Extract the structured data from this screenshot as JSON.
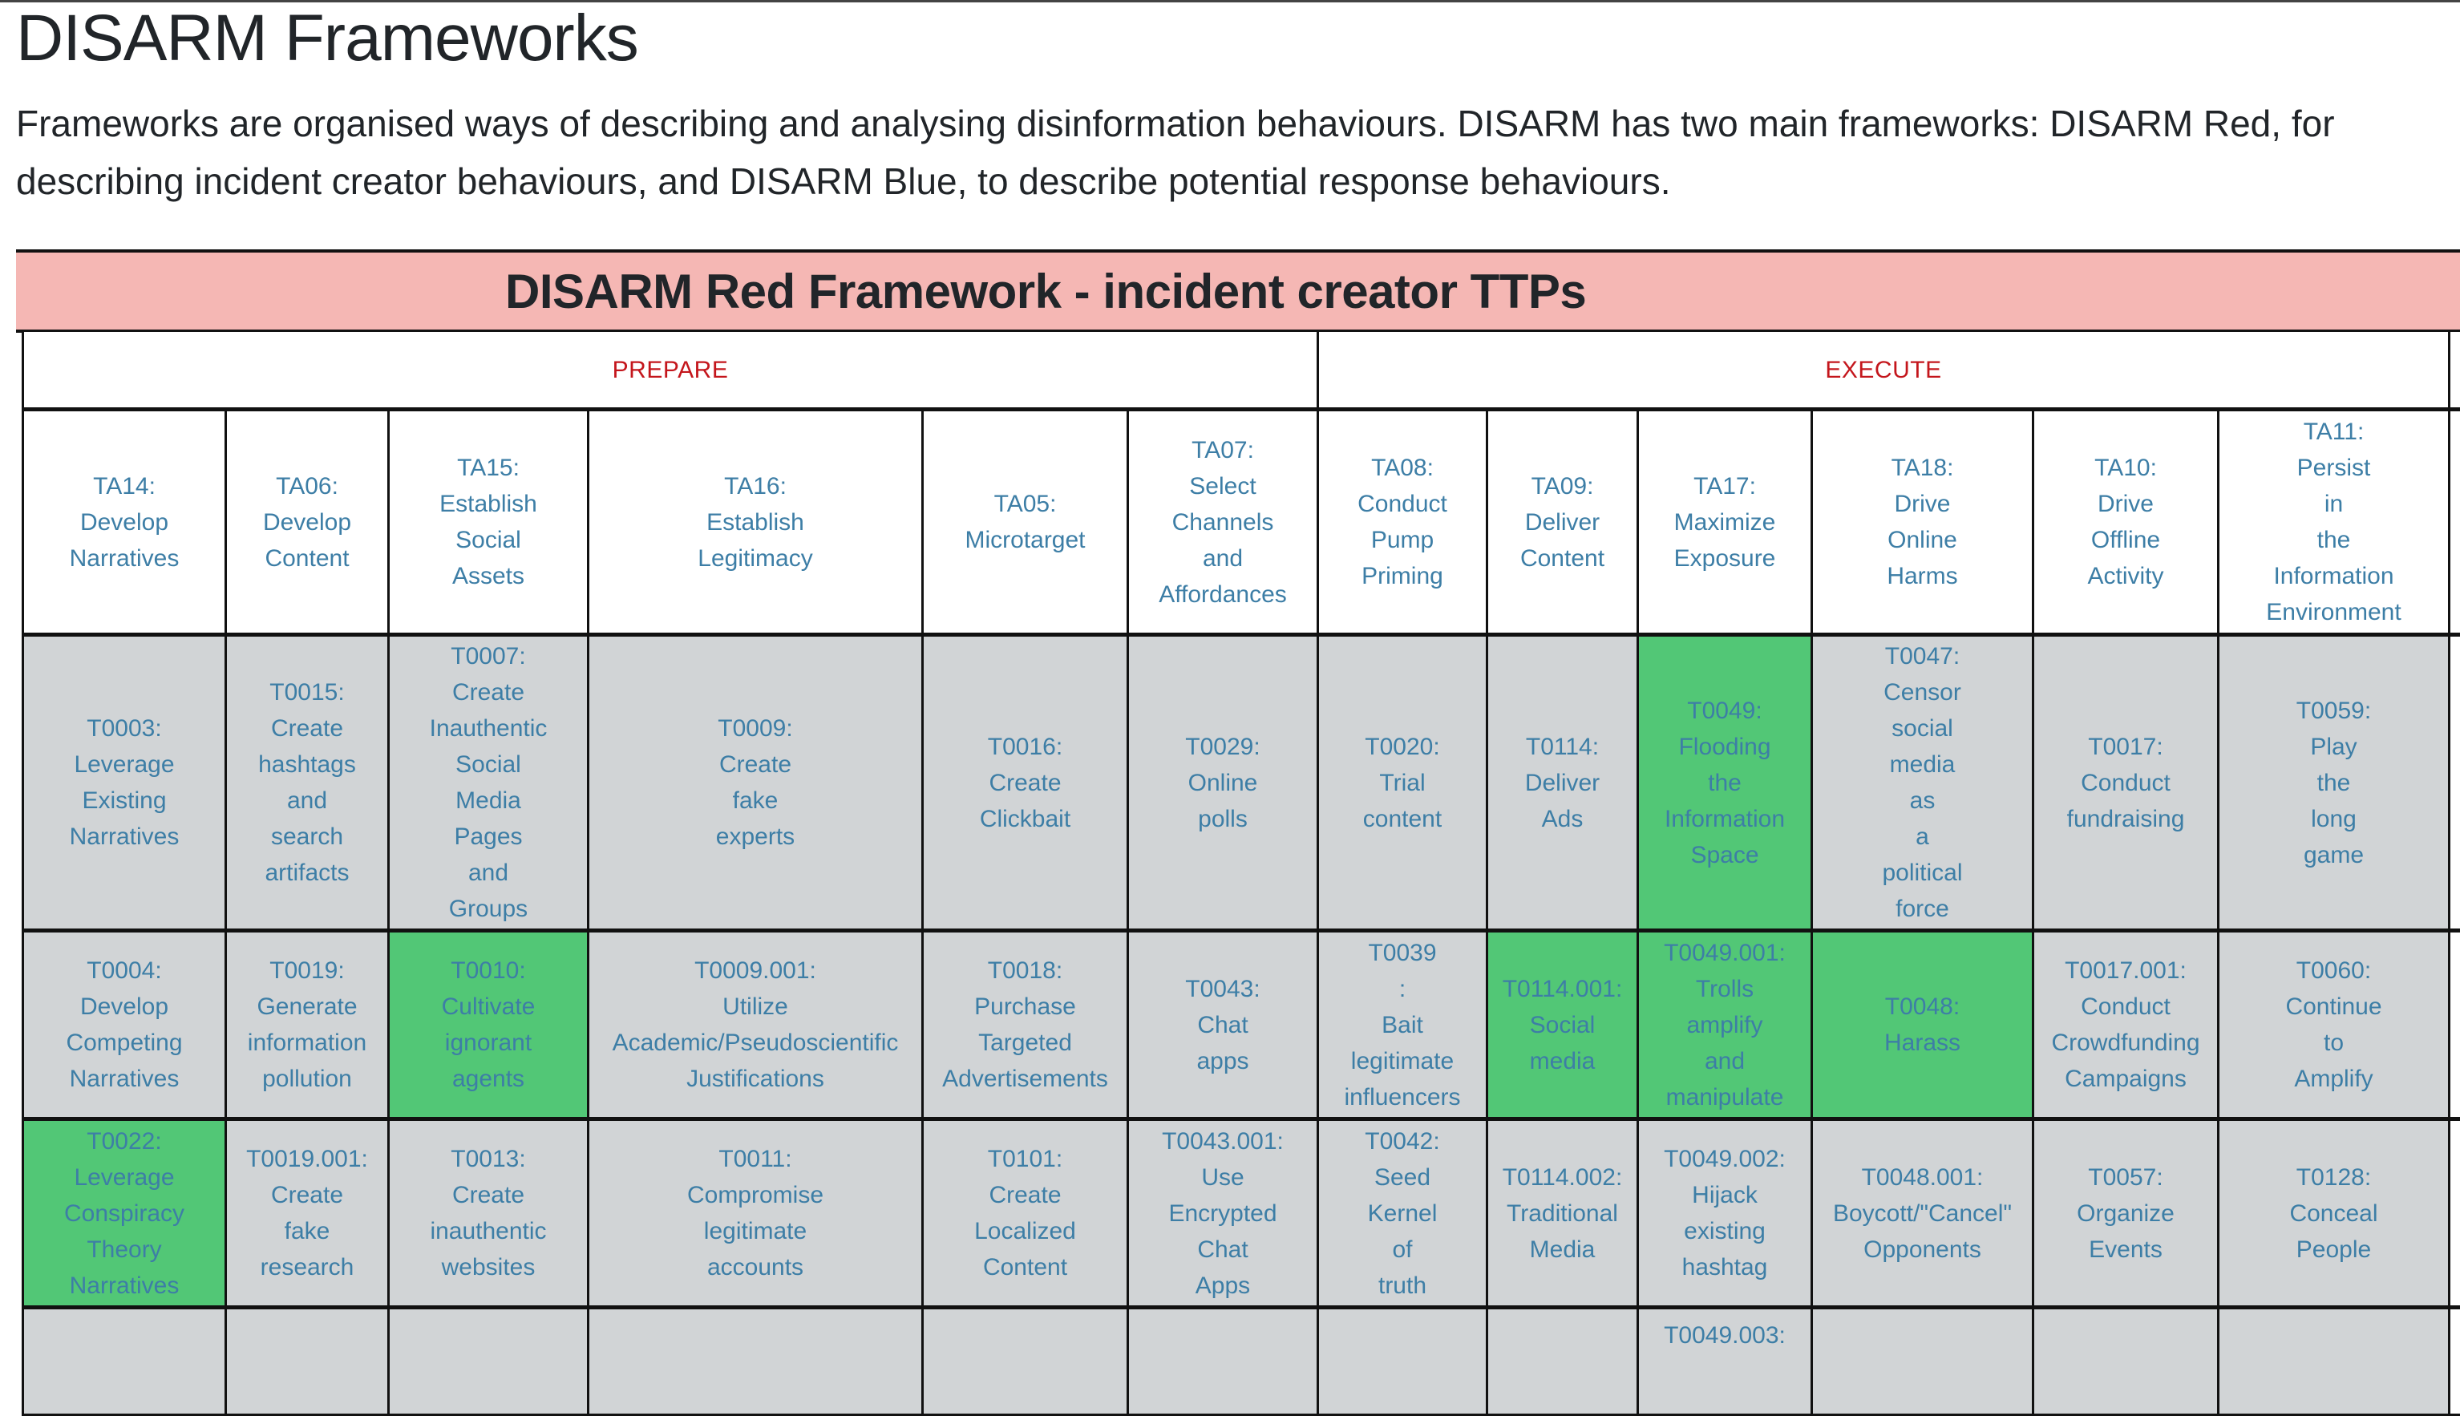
{
  "page": {
    "title": "DISARM Frameworks",
    "intro_lines": [
      "Frameworks are organised ways of describing and analysing disinformation behaviours. DISARM has two main frameworks: DISARM Red, for",
      "describing incident creator behaviours, and DISARM Blue, to describe potential response behaviours."
    ]
  },
  "framework": {
    "title": "DISARM Red Framework - incident creator TTPs",
    "colors": {
      "band": "#f5b7b4",
      "phase_text": "#c4161c",
      "link_text": "#3d7ea6",
      "cell": "#d1d4d6",
      "highlight": "#52c776"
    },
    "phases": [
      {
        "label": "PREPARE"
      },
      {
        "label": "EXECUTE"
      }
    ],
    "tactics": [
      "TA14: Develop Narratives",
      "TA06: Develop Content",
      "TA15: Establish Social Assets",
      "TA16: Establish Legitimacy",
      "TA05: Microtarget",
      "TA07: Select Channels and Affordances",
      "TA08: Conduct Pump Priming",
      "TA09: Deliver Content",
      "TA17: Maximize Exposure",
      "TA18: Drive Online Harms",
      "TA10: Drive Offline Activity",
      "TA11: Persist in the Information Environment"
    ],
    "rows": [
      [
        {
          "text": "T0003: Leverage Existing Narratives",
          "highlighted": false
        },
        {
          "text": "T0015: Create hashtags and search artifacts",
          "highlighted": false
        },
        {
          "text": "T0007: Create Inauthentic Social Media Pages and Groups",
          "highlighted": false
        },
        {
          "text": "T0009: Create fake experts",
          "highlighted": false
        },
        {
          "text": "T0016: Create Clickbait",
          "highlighted": false
        },
        {
          "text": "T0029: Online polls",
          "highlighted": false
        },
        {
          "text": "T0020: Trial content",
          "highlighted": false
        },
        {
          "text": "T0114: Deliver Ads",
          "highlighted": false
        },
        {
          "text": "T0049: Flooding the Information Space",
          "highlighted": true
        },
        {
          "text": "T0047: Censor social media as a political force",
          "highlighted": false
        },
        {
          "text": "T0017: Conduct fundraising",
          "highlighted": false
        },
        {
          "text": "T0059: Play the long game",
          "highlighted": false
        }
      ],
      [
        {
          "text": "T0004: Develop Competing Narratives",
          "highlighted": false
        },
        {
          "text": "T0019: Generate information pollution",
          "highlighted": false
        },
        {
          "text": "T0010: Cultivate ignorant agents",
          "highlighted": true
        },
        {
          "text": "T0009.001: Utilize Academic/Pseudoscientific Justifications",
          "highlighted": false
        },
        {
          "text": "T0018: Purchase Targeted Advertisements",
          "highlighted": false
        },
        {
          "text": "T0043: Chat apps",
          "highlighted": false
        },
        {
          "text": "T0039 : Bait legitimate influencers",
          "highlighted": false
        },
        {
          "text": "T0114.001: Social media",
          "highlighted": true
        },
        {
          "text": "T0049.001: Trolls amplify and manipulate",
          "highlighted": true
        },
        {
          "text": "T0048: Harass",
          "highlighted": true
        },
        {
          "text": "T0017.001: Conduct Crowdfunding Campaigns",
          "highlighted": false
        },
        {
          "text": "T0060: Continue to Amplify",
          "highlighted": false
        }
      ],
      [
        {
          "text": "T0022: Leverage Conspiracy Theory Narratives",
          "highlighted": true
        },
        {
          "text": "T0019.001: Create fake research",
          "highlighted": false
        },
        {
          "text": "T0013: Create inauthentic websites",
          "highlighted": false
        },
        {
          "text": "T0011: Compromise legitimate accounts",
          "highlighted": false
        },
        {
          "text": "T0101: Create Localized Content",
          "highlighted": false
        },
        {
          "text": "T0043.001: Use Encrypted Chat Apps",
          "highlighted": false
        },
        {
          "text": "T0042: Seed Kernel of truth",
          "highlighted": false
        },
        {
          "text": "T0114.002: Traditional Media",
          "highlighted": false
        },
        {
          "text": "T0049.002: Hijack existing hashtag",
          "highlighted": false
        },
        {
          "text": "T0048.001: Boycott/\"Cancel\" Opponents",
          "highlighted": false
        },
        {
          "text": "T0057: Organize Events",
          "highlighted": false
        },
        {
          "text": "T0128: Conceal People",
          "highlighted": false
        }
      ],
      [
        {
          "text": "",
          "highlighted": false
        },
        {
          "text": "",
          "highlighted": false
        },
        {
          "text": "",
          "highlighted": false
        },
        {
          "text": "",
          "highlighted": false
        },
        {
          "text": "",
          "highlighted": false
        },
        {
          "text": "",
          "highlighted": false
        },
        {
          "text": "",
          "highlighted": false
        },
        {
          "text": "",
          "highlighted": false
        },
        {
          "text": "T0049.003:",
          "highlighted": false
        },
        {
          "text": "",
          "highlighted": false
        },
        {
          "text": "",
          "highlighted": false
        },
        {
          "text": "",
          "highlighted": false
        }
      ]
    ]
  }
}
